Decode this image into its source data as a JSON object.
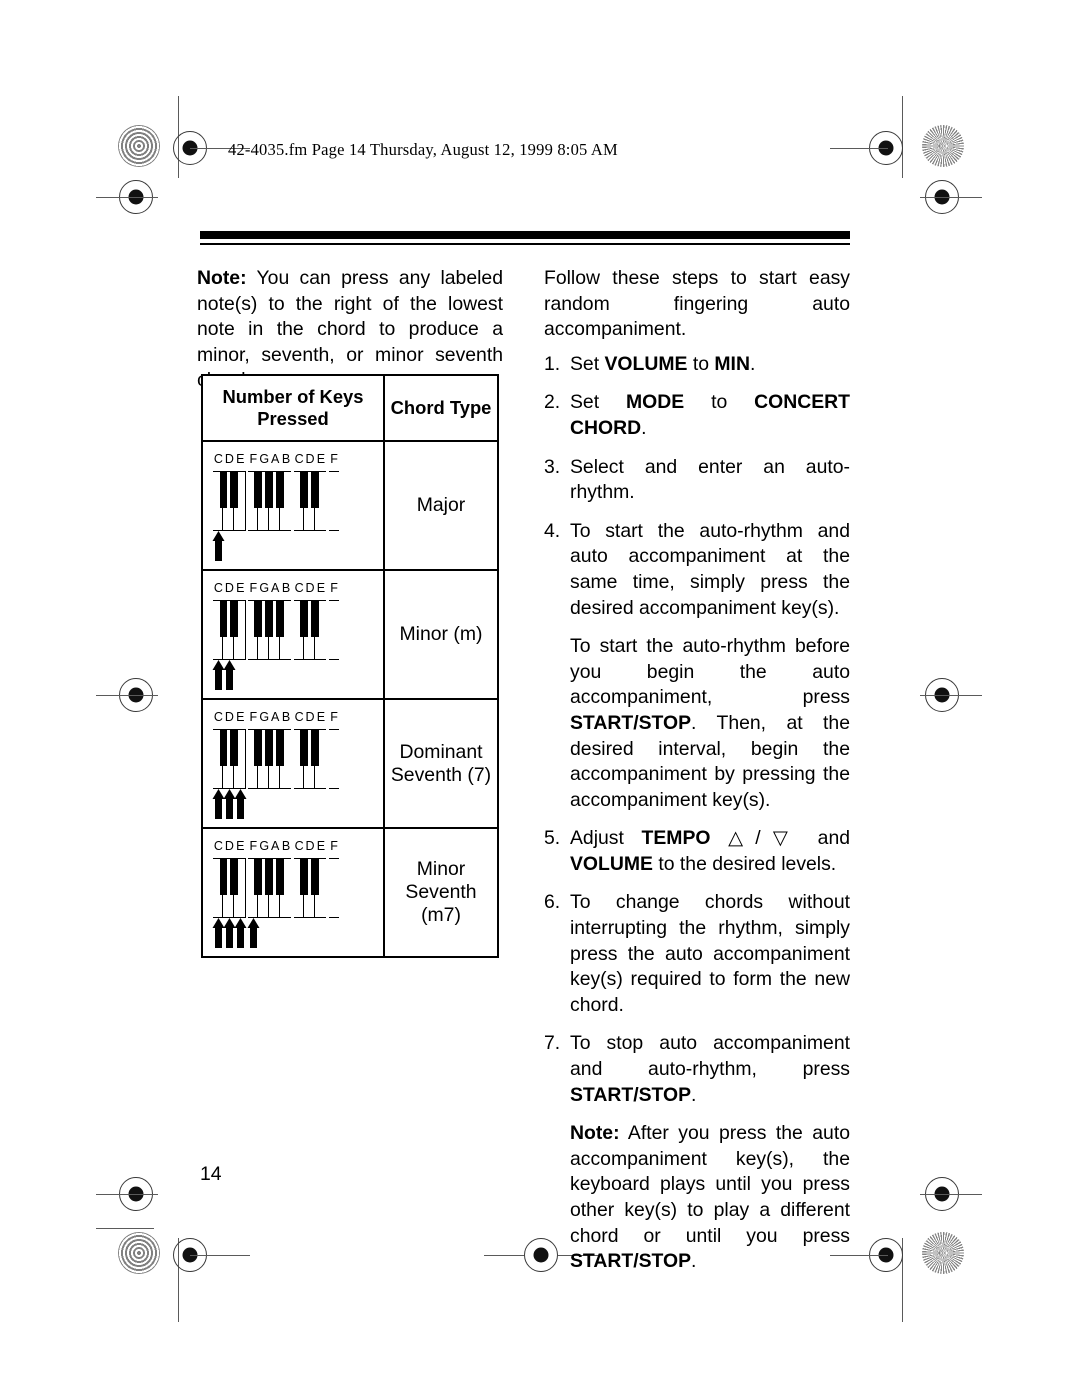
{
  "header": {
    "slug": "42-4035.fm  Page 14  Thursday, August 12, 1999  8:05 AM"
  },
  "page_number": "14",
  "left_column": {
    "note_label": "Note:",
    "note_text": " You can press any labeled note(s) to the right of the lowest note in the chord to produce a minor, seventh, or minor seventh chord."
  },
  "chord_table": {
    "headers": {
      "keys_pressed": "Number of Keys Pressed",
      "chord_type": "Chord Type"
    },
    "note_labels": [
      "C",
      "D",
      "E",
      "F",
      "G",
      "A",
      "B",
      "C",
      "D",
      "E",
      "F"
    ],
    "rows": [
      {
        "chord_type": "Major",
        "keys_pressed_count": 1,
        "pressed_notes": [
          "C"
        ]
      },
      {
        "chord_type": "Minor (m)",
        "keys_pressed_count": 2,
        "pressed_notes": [
          "C",
          "D"
        ]
      },
      {
        "chord_type": "Dominant Seventh (7)",
        "chord_type_line1": "Dominant",
        "chord_type_line2": "Seventh (7)",
        "keys_pressed_count": 3,
        "pressed_notes": [
          "C",
          "D",
          "E"
        ]
      },
      {
        "chord_type": "Minor Seventh (m7)",
        "chord_type_line1": "Minor",
        "chord_type_line2": "Seventh",
        "chord_type_line3": "(m7)",
        "keys_pressed_count": 4,
        "pressed_notes": [
          "C",
          "D",
          "E",
          "F"
        ]
      }
    ]
  },
  "right_column": {
    "intro": "Follow these steps to start easy random fingering auto accompaniment.",
    "steps": [
      {
        "num": "1.",
        "parts": [
          {
            "t": "Set ",
            "b": false
          },
          {
            "t": "VOLUME",
            "b": true
          },
          {
            "t": " to ",
            "b": false
          },
          {
            "t": "MIN",
            "b": true
          },
          {
            "t": ".",
            "b": false
          }
        ]
      },
      {
        "num": "2.",
        "parts": [
          {
            "t": "Set ",
            "b": false
          },
          {
            "t": "MODE",
            "b": true
          },
          {
            "t": " to ",
            "b": false
          },
          {
            "t": "CONCERT CHORD",
            "b": true
          },
          {
            "t": ".",
            "b": false
          }
        ]
      },
      {
        "num": "3.",
        "parts": [
          {
            "t": "Select and enter an auto-rhythm.",
            "b": false
          }
        ]
      },
      {
        "num": "4.",
        "parts": [
          {
            "t": "To start the auto-rhythm and auto accompaniment at the same time, simply press the desired accompaniment key(s).",
            "b": false
          }
        ]
      },
      {
        "num": "5.",
        "parts": [
          {
            "t": "Adjust ",
            "b": false
          },
          {
            "t": "TEMPO",
            "b": true
          },
          {
            "t": " △/▽ and ",
            "b": false
          },
          {
            "t": "VOLUME",
            "b": true
          },
          {
            "t": " to the desired levels.",
            "b": false
          }
        ]
      },
      {
        "num": "6.",
        "parts": [
          {
            "t": "To change chords without interrupting the rhythm, simply press the auto accompaniment key(s) required to form the new chord.",
            "b": false
          }
        ]
      },
      {
        "num": "7.",
        "parts": [
          {
            "t": "To stop auto accompaniment and auto-rhythm, press ",
            "b": false
          },
          {
            "t": "START/STOP",
            "b": true
          },
          {
            "t": ".",
            "b": false
          }
        ]
      }
    ],
    "sub_paragraph_4": [
      {
        "t": "To start the auto-rhythm before you begin the auto accompaniment, press ",
        "b": false
      },
      {
        "t": "START/STOP",
        "b": true
      },
      {
        "t": ". Then, at the desired interval, begin the accompaniment by pressing the accompaniment key(s).",
        "b": false
      }
    ],
    "final_note": [
      {
        "t": "Note:",
        "b": true
      },
      {
        "t": " After you press the auto accompaniment key(s), the keyboard plays until you press other key(s) to play a different chord or until you press ",
        "b": false
      },
      {
        "t": "START/STOP",
        "b": true
      },
      {
        "t": ".",
        "b": false
      }
    ]
  },
  "colors": {
    "ink": "#000000",
    "paper": "#ffffff",
    "registration": "#5a5a5a"
  }
}
